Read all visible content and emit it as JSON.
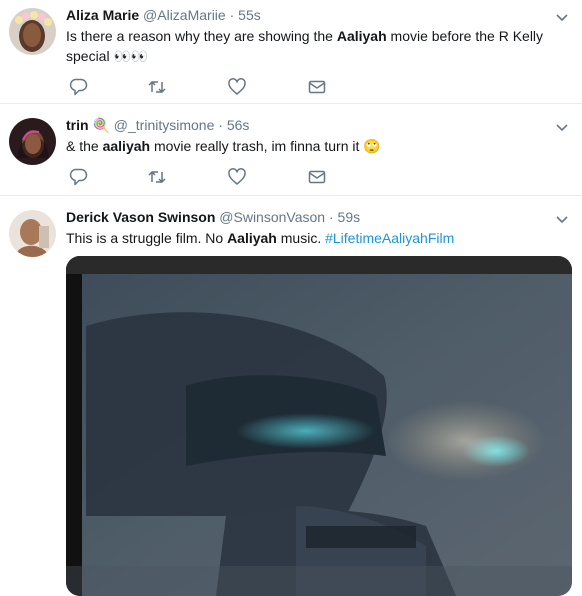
{
  "tweets": [
    {
      "name": "Aliza Marie",
      "handle": "@AlizaMariie",
      "sep": "·",
      "time": "55s",
      "text_pre": "Is there a reason why they are showing the ",
      "text_bold": "Aaliyah",
      "text_post": " movie before the R Kelly special ",
      "emoji": "👀👀"
    },
    {
      "name": "trin",
      "name_emoji": "🍭",
      "handle": "@_trinitysimone",
      "sep": "·",
      "time": "56s",
      "text_pre": "& the ",
      "text_bold": "aaliyah",
      "text_post": " movie really trash, im finna turn it ",
      "emoji": "🙄"
    },
    {
      "name": "Derick Vason Swinson",
      "handle": "@SwinsonVason",
      "sep": "·",
      "time": "59s",
      "text_pre": "This is a struggle film. No ",
      "text_bold": "Aaliyah",
      "text_post": " music. ",
      "hashtag": "#LifetimeAaliyahFilm"
    }
  ],
  "icons": {
    "reply": "reply-icon",
    "retweet": "retweet-icon",
    "like": "heart-icon",
    "dm": "envelope-icon",
    "menu": "chevron-down-icon"
  },
  "colors": {
    "text": "#14171a",
    "secondary": "#657786",
    "link": "#1b95e0",
    "divider": "#e6ecf0"
  }
}
